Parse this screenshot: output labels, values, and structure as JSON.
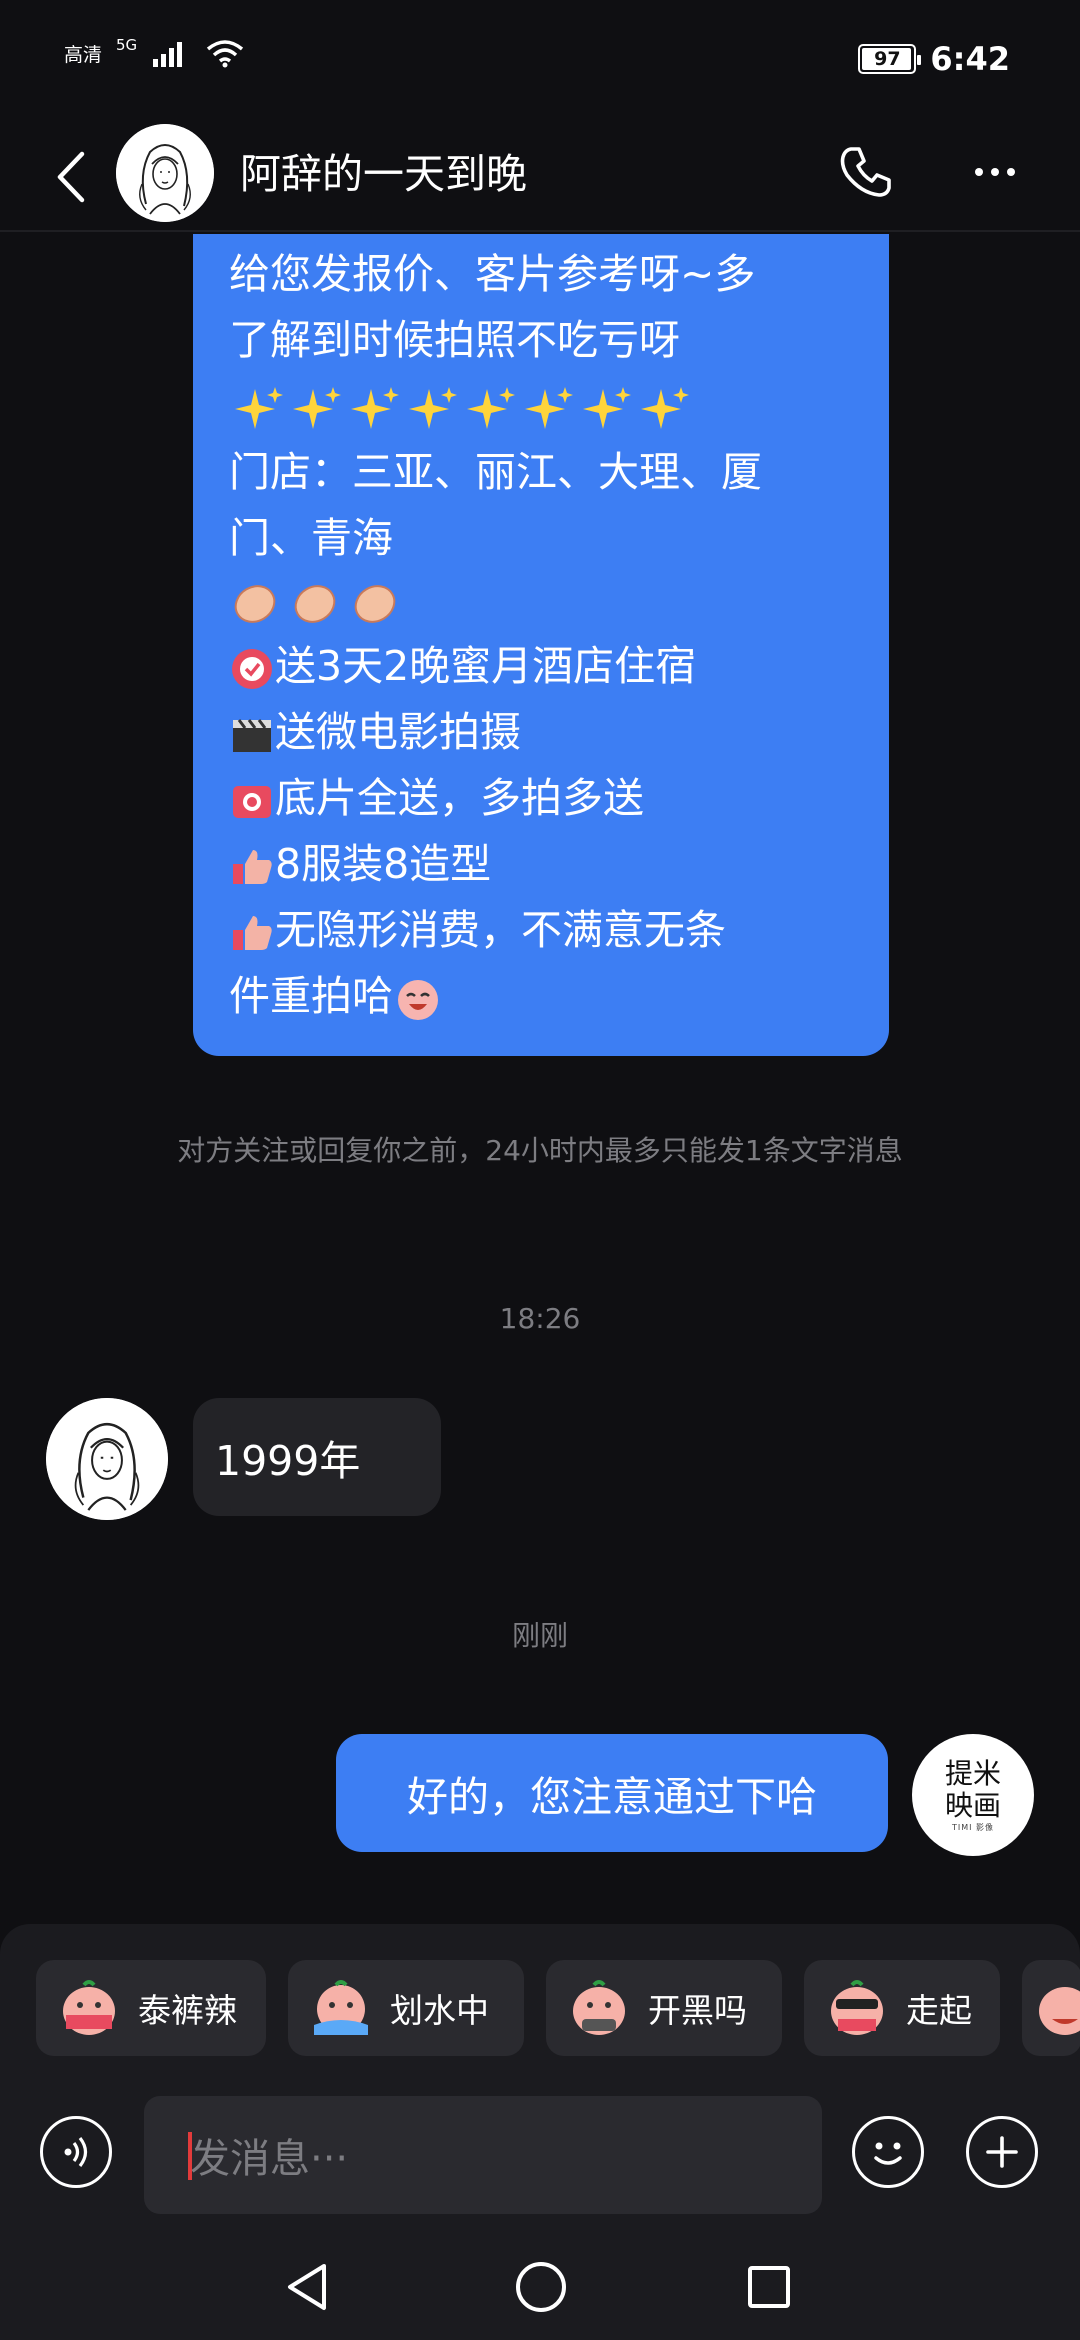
{
  "status_bar": {
    "carrier_label": "高清",
    "network": "5G",
    "battery": "97",
    "battery_level": 0.97,
    "time": "6:42"
  },
  "header": {
    "title": "阿辞的一天到晚",
    "avatar_icon": "line-drawing-girl-avatar",
    "call_icon": "phone-icon",
    "more_icon": "more-dots-icon"
  },
  "messages": {
    "promo": {
      "line1": "给您发报价、客片参考呀~多",
      "line2": "了解到时候拍照不吃亏呀",
      "sparkles": "✨✨✨✨✨✨✨✨",
      "line4": "门店：三亚、丽江、大理、厦",
      "line5": "门、青海",
      "item1": "送3天2晚蜜月酒店住宿",
      "item2": "送微电影拍摄",
      "item3": "底片全送，多拍多送",
      "item4": "8服装8造型",
      "item5a": "无隐形消费，不满意无条",
      "item5b": "件重拍哈"
    },
    "notice": "对方关注或回复你之前，24小时内最多只能发1条文字消息",
    "time1": "18:26",
    "incoming": "1999年",
    "time2": "刚刚",
    "outgoing": "好的，您注意通过下哈",
    "my_avatar": {
      "line1": "提米",
      "line2": "映画",
      "sub": "TIMI 影像"
    }
  },
  "quick_replies": [
    {
      "label": "泰裤辣",
      "icon": "sticker-face-icon"
    },
    {
      "label": "划水中",
      "icon": "sticker-face-icon"
    },
    {
      "label": "开黑吗",
      "icon": "sticker-face-icon"
    },
    {
      "label": "走起",
      "icon": "sticker-face-icon"
    }
  ],
  "composer": {
    "placeholder": "发消息···",
    "voice_icon": "voice-icon",
    "emoji_icon": "emoji-icon",
    "plus_icon": "plus-icon"
  },
  "colors": {
    "background": "#0f0f12",
    "my_bubble": "#3d7ef3",
    "their_bubble": "#232327",
    "muted_text": "#7d7d82"
  }
}
